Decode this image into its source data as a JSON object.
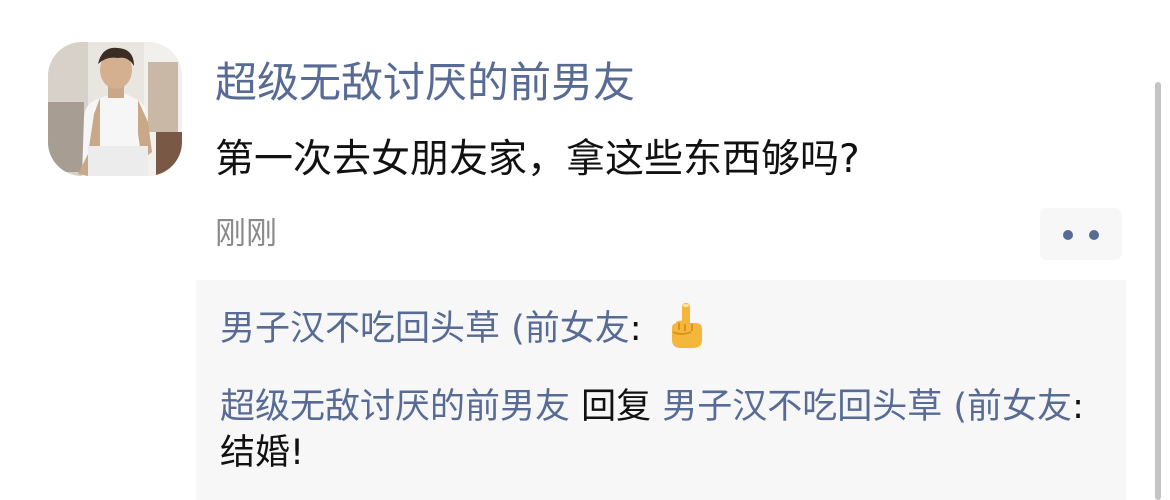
{
  "post": {
    "author": "超级无敌讨厌的前男友",
    "text": "第一次去女朋友家，拿这些东西够吗?",
    "timestamp": "刚刚",
    "avatar_icon": "profile-photo-person-in-tank-top",
    "more_icon": "more-dots-icon"
  },
  "comments": [
    {
      "author": "男子汉不吃回头草 (前女友",
      "separator": ": ",
      "emoji_icon": "middle-finger-emoji-icon"
    },
    {
      "author": "超级无敌讨厌的前男友",
      "reply_word": " 回复 ",
      "reply_to": "男子汉不吃回头草 (前女友",
      "separator": ": ",
      "text": "结婚!"
    }
  ],
  "colors": {
    "name_link": "#576b95",
    "body_text": "#111111",
    "timestamp": "#8a8a8a",
    "comment_bg": "#f7f7f7"
  }
}
